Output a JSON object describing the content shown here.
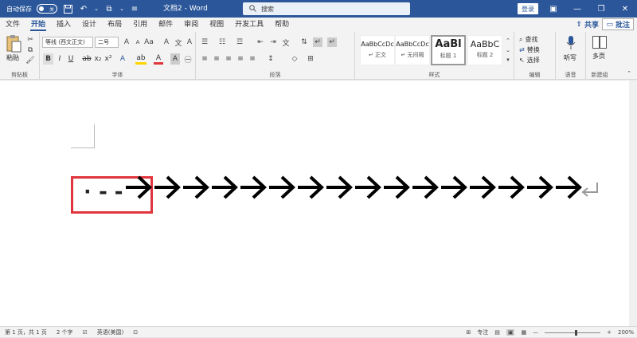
{
  "titlebar": {
    "autosave": "自动保存",
    "toggle_state": "关",
    "doc_title": "文档2 - Word",
    "search_placeholder": "搜索",
    "login": "登录"
  },
  "menu": {
    "tabs": [
      "文件",
      "开始",
      "插入",
      "设计",
      "布局",
      "引用",
      "邮件",
      "审阅",
      "视图",
      "开发工具",
      "帮助"
    ],
    "active": "开始",
    "share": "共享",
    "comment": "批注"
  },
  "ribbon": {
    "clipboard": {
      "paste": "粘贴",
      "label": "剪贴板"
    },
    "font": {
      "name": "等线 (西文正文)",
      "size": "二号",
      "label": "字体",
      "bold": "B",
      "italic": "I",
      "underline": "U"
    },
    "paragraph": {
      "label": "段落"
    },
    "styles": {
      "label": "样式",
      "items": [
        {
          "sample": "AaBbCcDc",
          "name": "↵ 正文"
        },
        {
          "sample": "AaBbCcDc",
          "name": "↵ 无间隔"
        },
        {
          "sample": "AaBl",
          "name": "标题 1"
        },
        {
          "sample": "AaBbC",
          "name": "标题 2"
        }
      ]
    },
    "editing": {
      "find": "查找",
      "replace": "替换",
      "select": "选择",
      "label": "编辑"
    },
    "voice": {
      "dictate": "听写",
      "label": "语音"
    },
    "newgroup": {
      "multipage": "多页",
      "label": "新建组"
    }
  },
  "document": {
    "leader_text": "·--",
    "arrow_count": 16
  },
  "statusbar": {
    "page": "第 1 页，共 1 页",
    "words": "2 个字",
    "language": "英语(美国)",
    "focus": "专注",
    "zoom": "200%"
  },
  "colors": {
    "accent": "#2b579a",
    "highlight_box": "#e0353d"
  }
}
